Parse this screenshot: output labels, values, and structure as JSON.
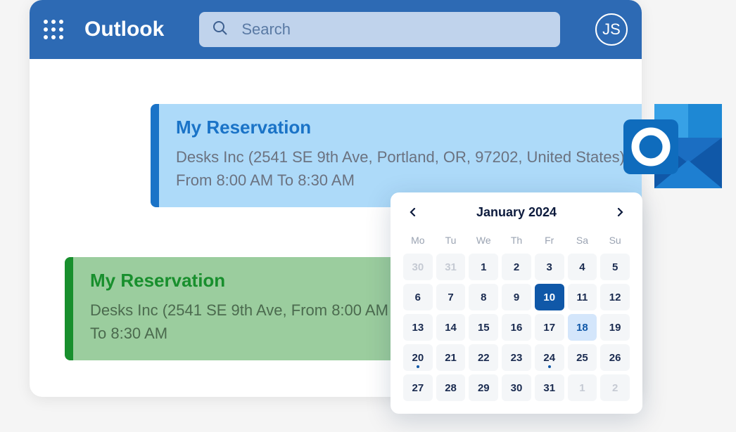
{
  "header": {
    "app_name": "Outlook",
    "search_placeholder": "Search",
    "avatar_initials": "JS"
  },
  "reservations": [
    {
      "title": "My Reservation",
      "description": "Desks Inc (2541 SE 9th Ave, Portland, OR, 97202, United States) From 8:00 AM To 8:30 AM"
    },
    {
      "title": "My Reservation",
      "description": "Desks Inc (2541 SE 9th Ave, From 8:00 AM To 8:30 AM"
    }
  ],
  "calendar": {
    "month_label": "January 2024",
    "dow": [
      "Mo",
      "Tu",
      "We",
      "Th",
      "Fr",
      "Sa",
      "Su"
    ],
    "weeks": [
      [
        {
          "d": "30",
          "muted": true
        },
        {
          "d": "31",
          "muted": true
        },
        {
          "d": "1"
        },
        {
          "d": "2"
        },
        {
          "d": "3"
        },
        {
          "d": "4"
        },
        {
          "d": "5"
        }
      ],
      [
        {
          "d": "6"
        },
        {
          "d": "7"
        },
        {
          "d": "8"
        },
        {
          "d": "9"
        },
        {
          "d": "10",
          "selected": true
        },
        {
          "d": "11"
        },
        {
          "d": "12"
        }
      ],
      [
        {
          "d": "13"
        },
        {
          "d": "14"
        },
        {
          "d": "15"
        },
        {
          "d": "16"
        },
        {
          "d": "17"
        },
        {
          "d": "18",
          "today": true
        },
        {
          "d": "19"
        }
      ],
      [
        {
          "d": "20",
          "dot": true
        },
        {
          "d": "21"
        },
        {
          "d": "22"
        },
        {
          "d": "23"
        },
        {
          "d": "24",
          "dot": true
        },
        {
          "d": "25"
        },
        {
          "d": "26"
        }
      ],
      [
        {
          "d": "27"
        },
        {
          "d": "28"
        },
        {
          "d": "29"
        },
        {
          "d": "30"
        },
        {
          "d": "31"
        },
        {
          "d": "1",
          "muted": true
        },
        {
          "d": "2",
          "muted": true
        }
      ]
    ]
  },
  "icons": {
    "outlook_logo": "outlook-logo"
  }
}
